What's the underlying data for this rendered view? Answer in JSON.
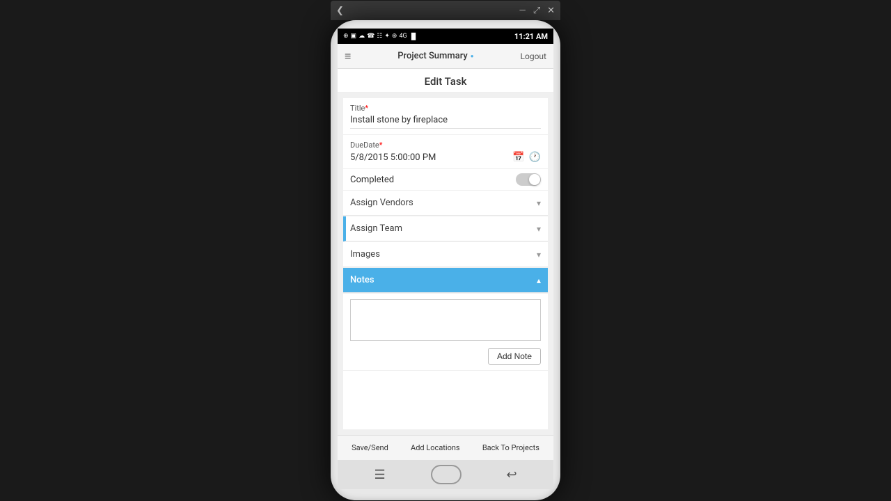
{
  "window": {
    "chevron": "❮",
    "minimize": "—",
    "maximize": "⤢",
    "close": "✕"
  },
  "statusBar": {
    "time": "11:21 AM",
    "icons": "⊕ ▣ ☁ ☎ ☷ ✦ ⊛ 4G ▐▌"
  },
  "header": {
    "menuIcon": "≡",
    "title": "Project Summary",
    "infoIcon": "●",
    "logout": "Logout"
  },
  "pageTitle": "Edit Task",
  "fields": {
    "titleLabel": "Title",
    "titleRequired": "*",
    "titleValue": "Install stone by fireplace",
    "dueDateLabel": "DueDate",
    "dueDateRequired": "*",
    "dueDateValue": "5/8/2015 5:00:00 PM",
    "completedLabel": "Completed"
  },
  "accordions": {
    "assignVendors": "Assign Vendors",
    "assignTeam": "Assign Team",
    "images": "Images",
    "notes": "Notes"
  },
  "notes": {
    "addNoteLabel": "Add Note",
    "placeholder": ""
  },
  "toolbar": {
    "saveSend": "Save/Send",
    "addLocations": "Add Locations",
    "backToProjects": "Back To Projects"
  },
  "phoneNav": {
    "menuIcon": "☰",
    "backIcon": "↩"
  }
}
